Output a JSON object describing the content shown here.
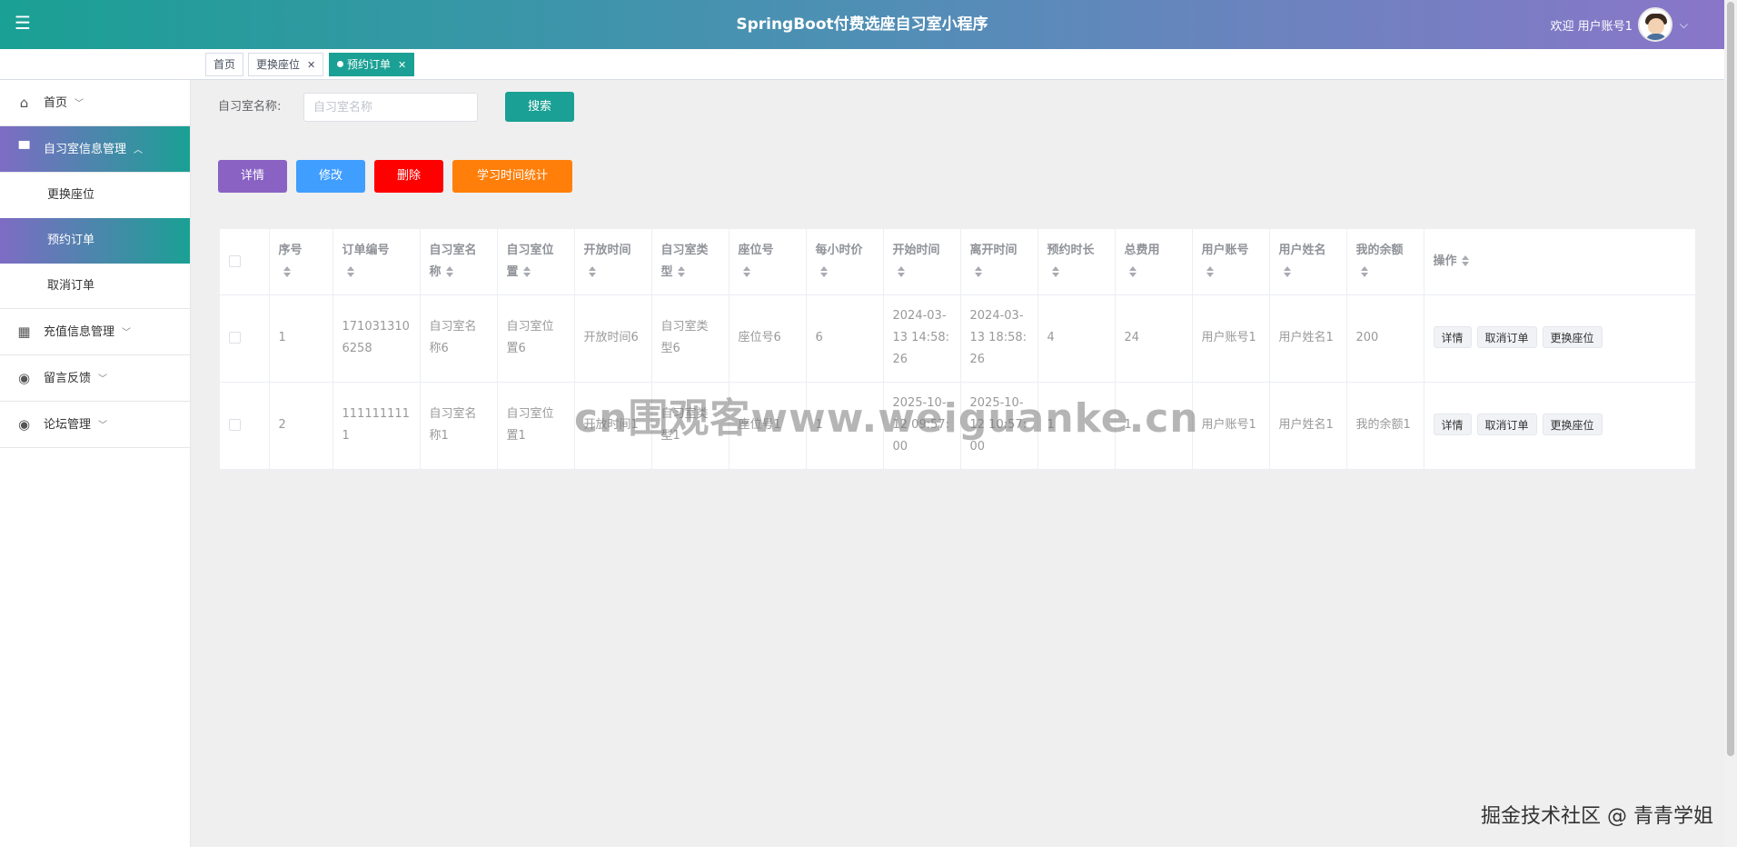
{
  "header": {
    "title": "SpringBoot付费选座自习室小程序",
    "welcome": "欢迎 用户账号1"
  },
  "tags": [
    {
      "label": "首页"
    },
    {
      "label": "更换座位"
    },
    {
      "label": "预约订单"
    }
  ],
  "sidebar": {
    "items": [
      {
        "label": "首页",
        "icon": "home-icon"
      },
      {
        "label": "自习室信息管理",
        "icon": "store-icon"
      },
      {
        "label": "更换座位"
      },
      {
        "label": "预约订单"
      },
      {
        "label": "取消订单"
      },
      {
        "label": "充值信息管理",
        "icon": "building-icon"
      },
      {
        "label": "留言反馈",
        "icon": "circle-icon"
      },
      {
        "label": "论坛管理",
        "icon": "circle-icon"
      }
    ]
  },
  "search": {
    "label": "自习室名称:",
    "placeholder": "自习室名称",
    "button": "搜索"
  },
  "toolbar": {
    "detail": "详情",
    "edit": "修改",
    "delete": "删除",
    "stats": "学习时间统计"
  },
  "table": {
    "headers": [
      "序号",
      "订单编号",
      "自习室名称",
      "自习室位置",
      "开放时间",
      "自习室类型",
      "座位号",
      "每小时价",
      "开始时间",
      "离开时间",
      "预约时长",
      "总费用",
      "用户账号",
      "用户姓名",
      "我的余额",
      "操作"
    ],
    "rows": [
      [
        "1",
        "1710313106258",
        "自习室名称6",
        "自习室位置6",
        "开放时间6",
        "自习室类型6",
        "座位号6",
        "6",
        "2024-03-13 14:58:26",
        "2024-03-13 18:58:26",
        "4",
        "24",
        "用户账号1",
        "用户姓名1",
        "200"
      ],
      [
        "2",
        "1111111111",
        "自习室名称1",
        "自习室位置1",
        "开放时间1",
        "自习室类型1",
        "座位号1",
        "1",
        "2025-10-12 09:57:00",
        "2025-10-12 10:57:00",
        "1",
        "1",
        "用户账号1",
        "用户姓名1",
        "我的余额1"
      ]
    ],
    "row_actions": {
      "detail": "详情",
      "cancel": "取消订单",
      "change_seat": "更换座位"
    }
  },
  "watermark": "cn围观客www.weiguanke.cn",
  "footer_mark": "掘金技术社区 @ 青青学姐",
  "colors": {
    "accent": "#1aa094",
    "purple": "#8962c4",
    "blue": "#409eff",
    "red": "#ff0000",
    "orange": "#ff7f0a"
  }
}
